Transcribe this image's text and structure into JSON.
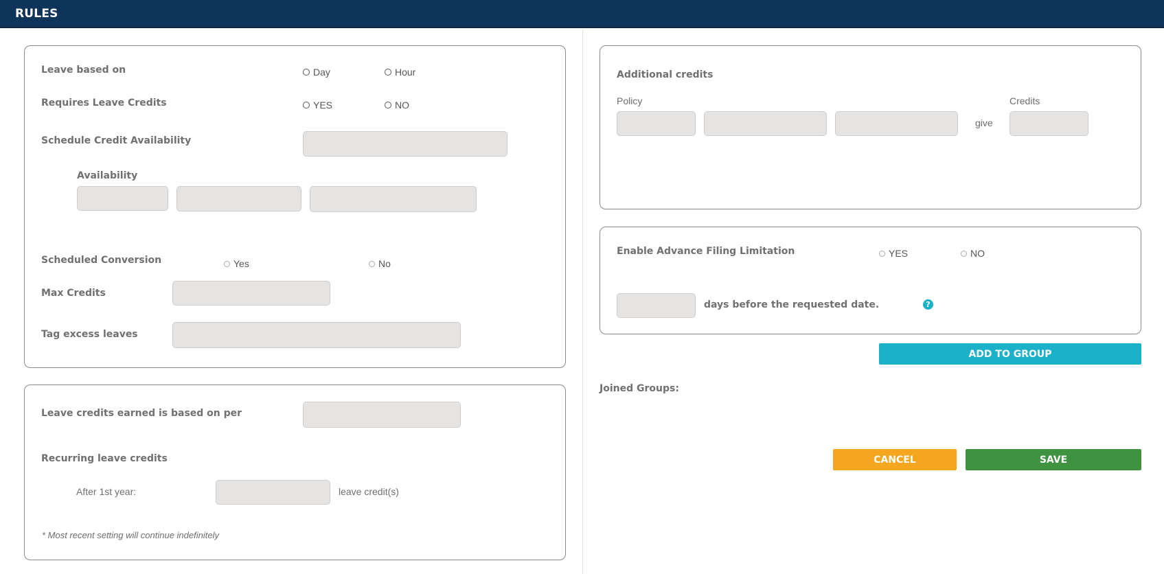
{
  "header": {
    "title": "RULES"
  },
  "rules_card": {
    "leave_based_on": {
      "label": "Leave based on",
      "options": [
        "Day",
        "Hour"
      ]
    },
    "requires_leave_credits": {
      "label": "Requires Leave Credits",
      "options": [
        "YES",
        "NO"
      ]
    },
    "schedule_credit_availability": {
      "label": "Schedule Credit Availability",
      "value": ""
    },
    "availability": {
      "label": "Availability",
      "fields": [
        "",
        "",
        ""
      ]
    },
    "scheduled_conversion": {
      "label": "Scheduled Conversion",
      "options": [
        "Yes",
        "No"
      ]
    },
    "max_credits": {
      "label": "Max Credits",
      "value": ""
    },
    "tag_excess_leaves": {
      "label": "Tag excess leaves",
      "value": ""
    }
  },
  "earned_card": {
    "earned_based_on": {
      "label": "Leave credits earned is based on per",
      "value": ""
    },
    "recurring": {
      "label": "Recurring leave credits"
    },
    "after_first_year": {
      "label": "After 1st year:",
      "value": "",
      "suffix": "leave credit(s)"
    },
    "note": "* Most recent setting will continue indefinitely"
  },
  "additional_card": {
    "title": "Additional credits",
    "policy_label": "Policy",
    "give_label": "give",
    "credits_label": "Credits"
  },
  "advance_card": {
    "label": "Enable Advance Filing Limitation",
    "options": [
      "YES",
      "NO"
    ],
    "days_text": "days before the requested date.",
    "help_icon": "question-circle-icon"
  },
  "buttons": {
    "add_to_group": "ADD TO GROUP",
    "cancel": "CANCEL",
    "save": "SAVE"
  },
  "joined_groups_label": "Joined Groups:",
  "colors": {
    "header": "#0f3459",
    "add": "#1bb1c8",
    "cancel": "#f3a61e",
    "save": "#3f9340",
    "field": "#e6e3e3"
  }
}
